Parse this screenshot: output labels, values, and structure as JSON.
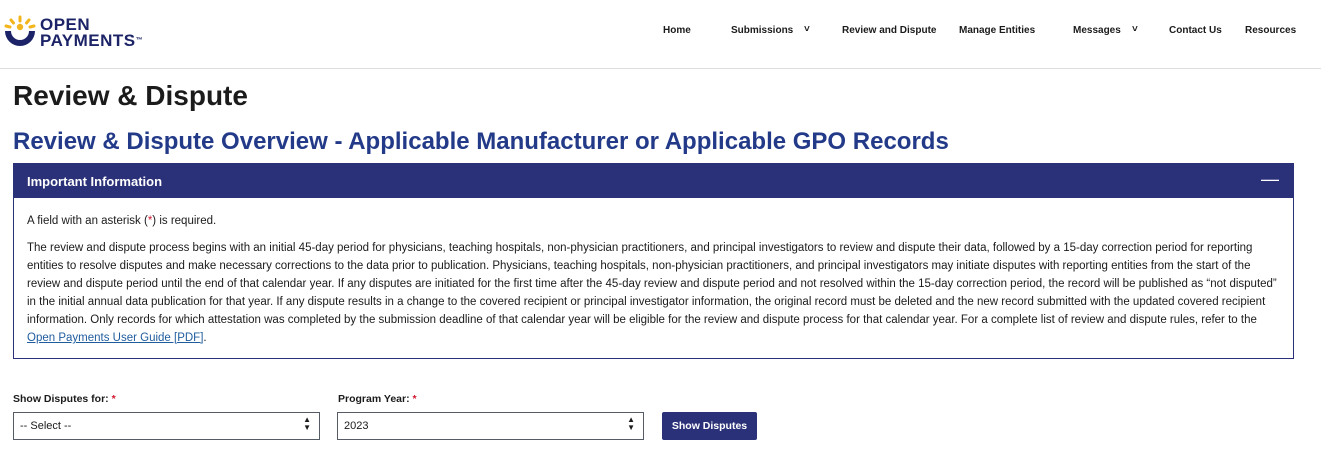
{
  "header": {
    "logo_line1": "OPEN",
    "logo_line2": "PAYMENTS",
    "logo_tm": "™",
    "nav": [
      {
        "label": "Home"
      },
      {
        "label": "Submissions"
      },
      {
        "label": "Review and Dispute"
      },
      {
        "label": "Manage Entities"
      },
      {
        "label": "Messages"
      },
      {
        "label": "Contact Us"
      },
      {
        "label": "Resources"
      }
    ],
    "chevron": "˅"
  },
  "page": {
    "title": "Review & Dispute",
    "section_title": "Review & Dispute Overview - Applicable Manufacturer or Applicable GPO Records"
  },
  "info_panel": {
    "title": "Important Information",
    "toggle": "—",
    "required_pre": "A field with an asterisk (",
    "required_star": "*",
    "required_post": ") is required.",
    "body": "The review and dispute process begins with an initial 45-day period for physicians, teaching hospitals, non-physician practitioners, and principal investigators to review and dispute their data, followed by a 15-day correction period for reporting entities to resolve disputes and make necessary corrections to the data prior to publication. Physicians, teaching hospitals, non-physician practitioners, and principal investigators may initiate disputes with reporting entities from the start of the review and dispute period until the end of that calendar year. If any disputes are initiated for the first time after the 45-day review and dispute period and not resolved within the 15-day correction period, the record will be published as “not disputed” in the initial annual data publication for that year. If any dispute results in a change to the covered recipient or principal investigator information, the original record must be deleted and the new record submitted with the updated covered recipient information. Only records for which attestation was completed by the submission deadline of that calendar year will be eligible for the review and dispute process for that calendar year. For a complete list of review and dispute rules, refer to the ",
    "link_text": "Open Payments User Guide [PDF]",
    "body_end": "."
  },
  "form": {
    "show_for_label": "Show Disputes for:",
    "program_year_label": "Program Year:",
    "asterisk": "*",
    "show_for_value": "-- Select --",
    "program_year_value": "2023",
    "button_label": "Show Disputes",
    "arrow_up": "▲",
    "arrow_down": "▼"
  },
  "colors": {
    "brand_navy": "#2b3178",
    "title_blue": "#233a89",
    "logo_gold": "#f2b51c",
    "logo_navy": "#1c2467",
    "required_red": "#d1162d"
  }
}
